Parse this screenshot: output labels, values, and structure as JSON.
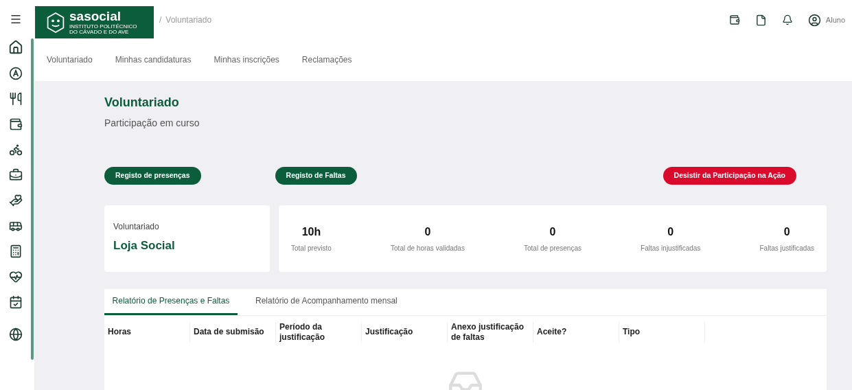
{
  "logo": {
    "name": "sasocial",
    "subtitle_1": "INSTITUTO POLITÉCNICO",
    "subtitle_2": "DO CÁVADO E DO AVE"
  },
  "breadcrumb": {
    "separator": "/",
    "current": "Voluntariado"
  },
  "user": {
    "name": "Aluno"
  },
  "nav_tabs": [
    {
      "label": "Voluntariado"
    },
    {
      "label": "Minhas candidaturas"
    },
    {
      "label": "Minhas inscrições"
    },
    {
      "label": "Reclamações"
    }
  ],
  "page": {
    "title": "Voluntariado",
    "subtitle": "Participação em curso"
  },
  "actions": [
    {
      "label": "Registo de presenças",
      "kind": "primary"
    },
    {
      "label": "Registo de Faltas",
      "kind": "primary"
    },
    {
      "label": "Desistir da Participação na Ação",
      "kind": "danger"
    }
  ],
  "action_card": {
    "label": "Voluntariado",
    "name": "Loja Social"
  },
  "stats": [
    {
      "value": "10h",
      "label": "Total previsto"
    },
    {
      "value": "0",
      "label": "Total de horas validadas"
    },
    {
      "value": "0",
      "label": "Total de presenças"
    },
    {
      "value": "0",
      "label": "Faltas injustificadas"
    },
    {
      "value": "0",
      "label": "Faltas justificadas"
    }
  ],
  "report_tabs": [
    {
      "label": "Relatório de Presenças e Faltas",
      "selected": true
    },
    {
      "label": "Relatório de Acompanhamento mensal",
      "selected": false
    }
  ],
  "table": {
    "columns": [
      "Horas",
      "Data de submisão",
      "Período da justificação",
      "Justificação",
      "Anexo justificação de faltas",
      "Aceite?",
      "Tipo"
    ]
  }
}
